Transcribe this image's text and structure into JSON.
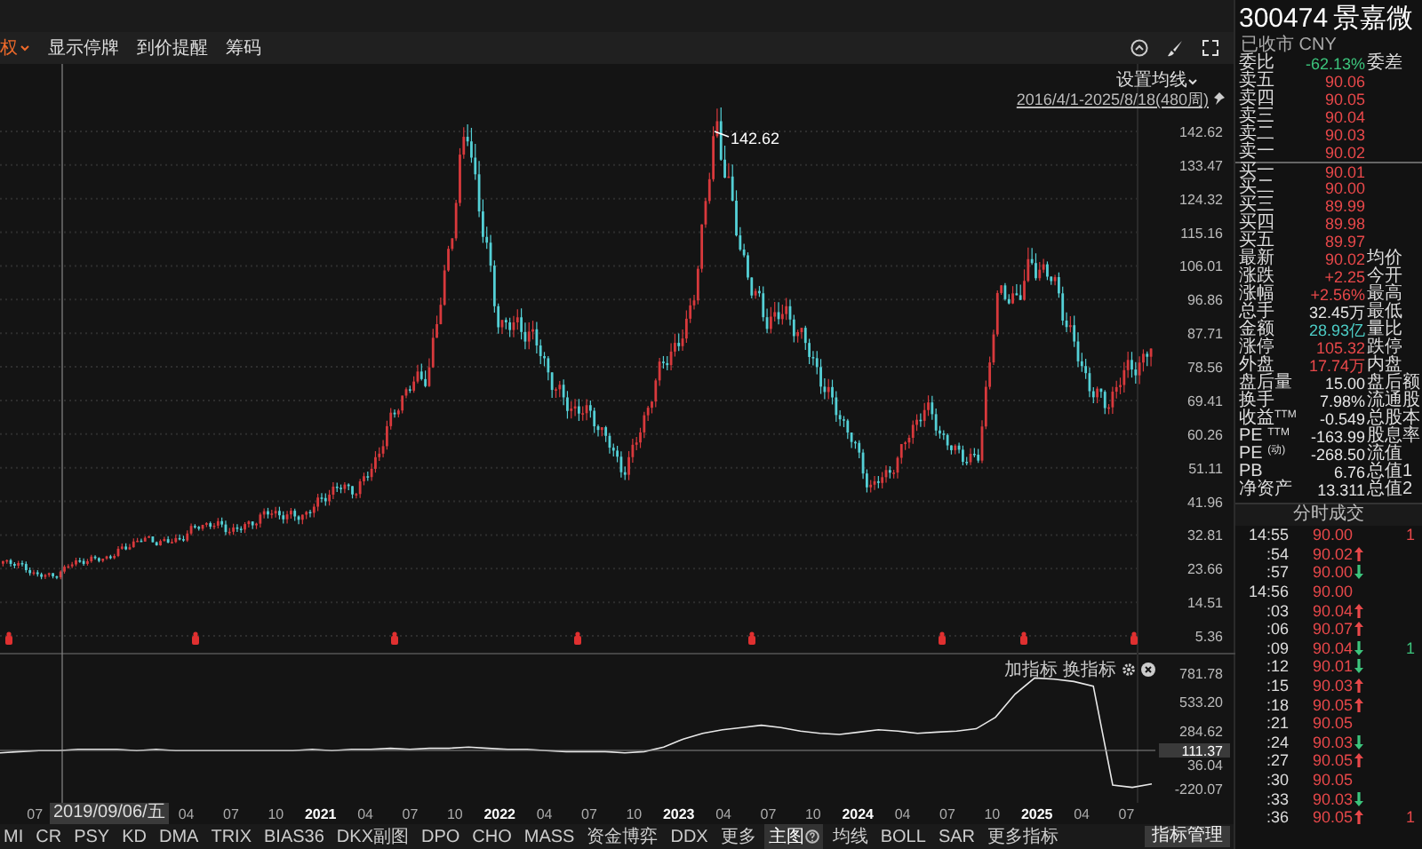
{
  "toolbar": {
    "items": [
      {
        "label": "权",
        "kind": "dropdown"
      },
      {
        "label": "显示停牌",
        "kind": "plain"
      },
      {
        "label": "到价提醒",
        "kind": "plain"
      },
      {
        "label": "筹码",
        "kind": "plain"
      }
    ]
  },
  "chart": {
    "ma_button": "设置均线",
    "range": "2016/4/1-2025/8/18(480周)",
    "peak_label": "142.62",
    "price_ticks": [
      "142.62",
      "133.47",
      "124.32",
      "115.16",
      "106.01",
      "96.86",
      "87.71",
      "78.56",
      "69.41",
      "60.26",
      "51.11",
      "41.96",
      "32.81",
      "23.66",
      "14.51",
      "5.36"
    ],
    "indicator": {
      "actions": [
        "加指标",
        "换指标"
      ],
      "crosshair_value": "111.37",
      "chart_data": {
        "type": "line",
        "ylim": [
          -220.07,
          781.78
        ],
        "yticks": [
          {
            "value": 781.78,
            "label": "781.78"
          },
          {
            "value": 533.2,
            "label": "533.20"
          },
          {
            "value": 284.62,
            "label": "284.62"
          },
          {
            "value": 36.04,
            "label": "36.04"
          },
          {
            "value": -220.07,
            "label": "-220.07"
          }
        ],
        "series": [
          {
            "color": "#e8e8e8",
            "values": [
              90,
              100,
              110,
              110,
              120,
              120,
              120,
              110,
              120,
              110,
              110,
              110,
              110,
              110,
              110,
              110,
              120,
              110,
              120,
              120,
              130,
              120,
              130,
              130,
              140,
              130,
              120,
              120,
              110,
              100,
              100,
              100,
              90,
              100,
              140,
              210,
              260,
              290,
              310,
              330,
              310,
              280,
              260,
              250,
              270,
              290,
              280,
              260,
              270,
              280,
              300,
              400,
              600,
              740,
              730,
              710,
              670,
              -190,
              -210,
              -180
            ]
          }
        ]
      }
    },
    "crosshair_date": "2019/09/06/五",
    "x_labels": [
      {
        "label": "07",
        "kind": "month"
      },
      {
        "label": "04",
        "kind": "month"
      },
      {
        "label": "07",
        "kind": "month"
      },
      {
        "label": "10",
        "kind": "month"
      },
      {
        "label": "2021",
        "kind": "year"
      },
      {
        "label": "04",
        "kind": "month"
      },
      {
        "label": "07",
        "kind": "month"
      },
      {
        "label": "10",
        "kind": "month"
      },
      {
        "label": "2022",
        "kind": "year"
      },
      {
        "label": "04",
        "kind": "month"
      },
      {
        "label": "07",
        "kind": "month"
      },
      {
        "label": "10",
        "kind": "month"
      },
      {
        "label": "2023",
        "kind": "year"
      },
      {
        "label": "04",
        "kind": "month"
      },
      {
        "label": "07",
        "kind": "month"
      },
      {
        "label": "10",
        "kind": "month"
      },
      {
        "label": "2024",
        "kind": "year"
      },
      {
        "label": "04",
        "kind": "month"
      },
      {
        "label": "07",
        "kind": "month"
      },
      {
        "label": "10",
        "kind": "month"
      },
      {
        "label": "2025",
        "kind": "year"
      },
      {
        "label": "04",
        "kind": "month"
      },
      {
        "label": "07",
        "kind": "month"
      }
    ]
  },
  "indicator_tabs": [
    {
      "label": "MI",
      "selected": false,
      "help_icon": false
    },
    {
      "label": "CR",
      "selected": false,
      "help_icon": false
    },
    {
      "label": "PSY",
      "selected": false,
      "help_icon": false
    },
    {
      "label": "KD",
      "selected": false,
      "help_icon": false
    },
    {
      "label": "DMA",
      "selected": false,
      "help_icon": false
    },
    {
      "label": "TRIX",
      "selected": false,
      "help_icon": false
    },
    {
      "label": "BIAS36",
      "selected": false,
      "help_icon": false
    },
    {
      "label": "DKX副图",
      "selected": false,
      "help_icon": false
    },
    {
      "label": "DPO",
      "selected": false,
      "help_icon": false
    },
    {
      "label": "CHO",
      "selected": false,
      "help_icon": false
    },
    {
      "label": "MASS",
      "selected": false,
      "help_icon": false
    },
    {
      "label": "资金博弈",
      "selected": false,
      "help_icon": false
    },
    {
      "label": "DDX",
      "selected": false,
      "help_icon": false
    },
    {
      "label": "更多",
      "selected": false,
      "help_icon": false
    },
    {
      "label": "主图",
      "selected": true,
      "help_icon": true
    },
    {
      "label": "均线",
      "selected": false,
      "help_icon": false
    },
    {
      "label": "BOLL",
      "selected": false,
      "help_icon": false
    },
    {
      "label": "SAR",
      "selected": false,
      "help_icon": false
    },
    {
      "label": "更多指标",
      "selected": false,
      "help_icon": false
    }
  ],
  "manage_button": "指标管理",
  "quote": {
    "code": "300474",
    "name": "景嘉微",
    "status": "已收市 CNY",
    "rows": [
      {
        "label": "委比",
        "value": "-62.13%",
        "color": "#3cc47c",
        "right": "委差"
      },
      {
        "label": "卖五",
        "value": "90.06",
        "color": "#e8484a"
      },
      {
        "label": "卖四",
        "value": "90.05",
        "color": "#e8484a"
      },
      {
        "label": "卖三",
        "value": "90.04",
        "color": "#e8484a"
      },
      {
        "label": "卖二",
        "value": "90.03",
        "color": "#e8484a"
      },
      {
        "label": "卖一",
        "value": "90.02",
        "color": "#e8484a"
      },
      {
        "label": "买一",
        "value": "90.01",
        "color": "#e8484a"
      },
      {
        "label": "买二",
        "value": "90.00",
        "color": "#e8484a"
      },
      {
        "label": "买三",
        "value": "89.99",
        "color": "#e8484a"
      },
      {
        "label": "买四",
        "value": "89.98",
        "color": "#e8484a"
      },
      {
        "label": "买五",
        "value": "89.97",
        "color": "#e8484a"
      },
      {
        "label": "最新",
        "value": "90.02",
        "color": "#e8484a",
        "right": "均价"
      },
      {
        "label": "涨跌",
        "value": "+2.25",
        "color": "#e8484a",
        "right": "今开"
      },
      {
        "label": "涨幅",
        "value": "+2.56%",
        "color": "#e8484a",
        "right": "最高"
      },
      {
        "label": "总手",
        "value": "32.45万",
        "color": "#e6e6e6",
        "right": "最低"
      },
      {
        "label": "金额",
        "value": "28.93亿",
        "color": "#4ccdc6",
        "right": "量比"
      },
      {
        "label": "涨停",
        "value": "105.32",
        "color": "#e8484a",
        "right": "跌停"
      },
      {
        "label": "外盘",
        "value": "17.74万",
        "color": "#e8484a",
        "right": "内盘"
      },
      {
        "label": "盘后量",
        "value": "15.00",
        "color": "#e6e6e6",
        "right": "盘后额"
      },
      {
        "label": "换手",
        "value": "7.98%",
        "color": "#e6e6e6",
        "right": "流通股"
      },
      {
        "label": "收益$^{TTM}$",
        "value": "-0.549",
        "color": "#e6e6e6",
        "right": "总股本"
      },
      {
        "label": "PE $^{TTM}$",
        "value": "-163.99",
        "color": "#e6e6e6",
        "right": "股息率"
      },
      {
        "label": "PE $^{(动)}$",
        "value": "-268.50",
        "color": "#e6e6e6",
        "right": "流值"
      },
      {
        "label": "PB",
        "value": "6.76",
        "color": "#e6e6e6",
        "right": "总值1"
      },
      {
        "label": "净资产",
        "value": "13.311",
        "color": "#e6e6e6",
        "right": "总值2"
      }
    ]
  },
  "trades": {
    "title": "分时成交",
    "rows": [
      {
        "time": "14:55",
        "price": "90.00",
        "kind": "flat",
        "volume": "1",
        "color": "#e8484a"
      },
      {
        "time": ":54",
        "price": "90.02",
        "kind": "up"
      },
      {
        "time": ":57",
        "price": "90.00",
        "kind": "down"
      },
      {
        "time": "14:56",
        "price": "90.00",
        "kind": "flat"
      },
      {
        "time": ":03",
        "price": "90.04",
        "kind": "up"
      },
      {
        "time": ":06",
        "price": "90.07",
        "kind": "up"
      },
      {
        "time": ":09",
        "price": "90.04",
        "kind": "down",
        "volume": "1",
        "color": "#3cc47c"
      },
      {
        "time": ":12",
        "price": "90.01",
        "kind": "down"
      },
      {
        "time": ":15",
        "price": "90.03",
        "kind": "up"
      },
      {
        "time": ":18",
        "price": "90.05",
        "kind": "up"
      },
      {
        "time": ":21",
        "price": "90.05",
        "kind": "flat"
      },
      {
        "time": ":24",
        "price": "90.03",
        "kind": "down"
      },
      {
        "time": ":27",
        "price": "90.05",
        "kind": "up"
      },
      {
        "time": ":30",
        "price": "90.05",
        "kind": "flat"
      },
      {
        "time": ":33",
        "price": "90.03",
        "kind": "down"
      },
      {
        "time": ":36",
        "price": "90.05",
        "kind": "up",
        "volume": "1",
        "color": "#e8484a"
      }
    ]
  }
}
